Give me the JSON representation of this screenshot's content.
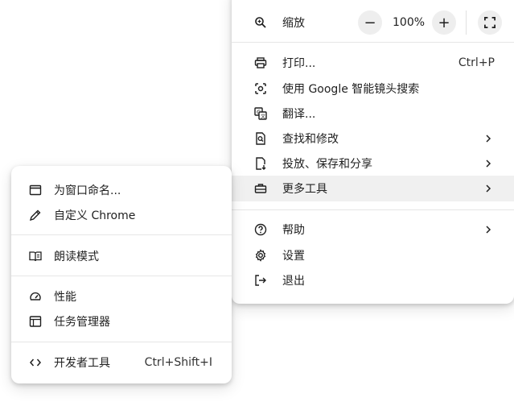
{
  "main_menu": {
    "zoom": {
      "label": "缩放",
      "minus": "−",
      "value": "100%",
      "plus": "+"
    },
    "items": [
      {
        "label": "打印...",
        "shortcut": "Ctrl+P",
        "icon": "printer-icon"
      },
      {
        "label": "使用 Google 智能镜头搜索",
        "icon": "google-lens-icon"
      },
      {
        "label": "翻译...",
        "icon": "translate-icon"
      },
      {
        "label": "查找和修改",
        "icon": "find-icon"
      },
      {
        "label": "投放、保存和分享",
        "icon": "cast-save-share-icon"
      },
      {
        "label": "更多工具",
        "icon": "toolbox-icon"
      },
      {
        "label": "帮助",
        "icon": "help-icon"
      },
      {
        "label": "设置",
        "icon": "gear-icon"
      },
      {
        "label": "退出",
        "icon": "exit-icon"
      }
    ]
  },
  "sub_menu": {
    "items": [
      {
        "label": "为窗口命名...",
        "icon": "window-icon"
      },
      {
        "label": "自定义 Chrome",
        "icon": "pencil-icon"
      },
      {
        "label": "朗读模式",
        "icon": "reading-mode-icon"
      },
      {
        "label": "性能",
        "icon": "speedometer-icon"
      },
      {
        "label": "任务管理器",
        "icon": "task-manager-icon"
      },
      {
        "label": "开发者工具",
        "shortcut": "Ctrl+Shift+I",
        "icon": "code-icon"
      }
    ]
  }
}
